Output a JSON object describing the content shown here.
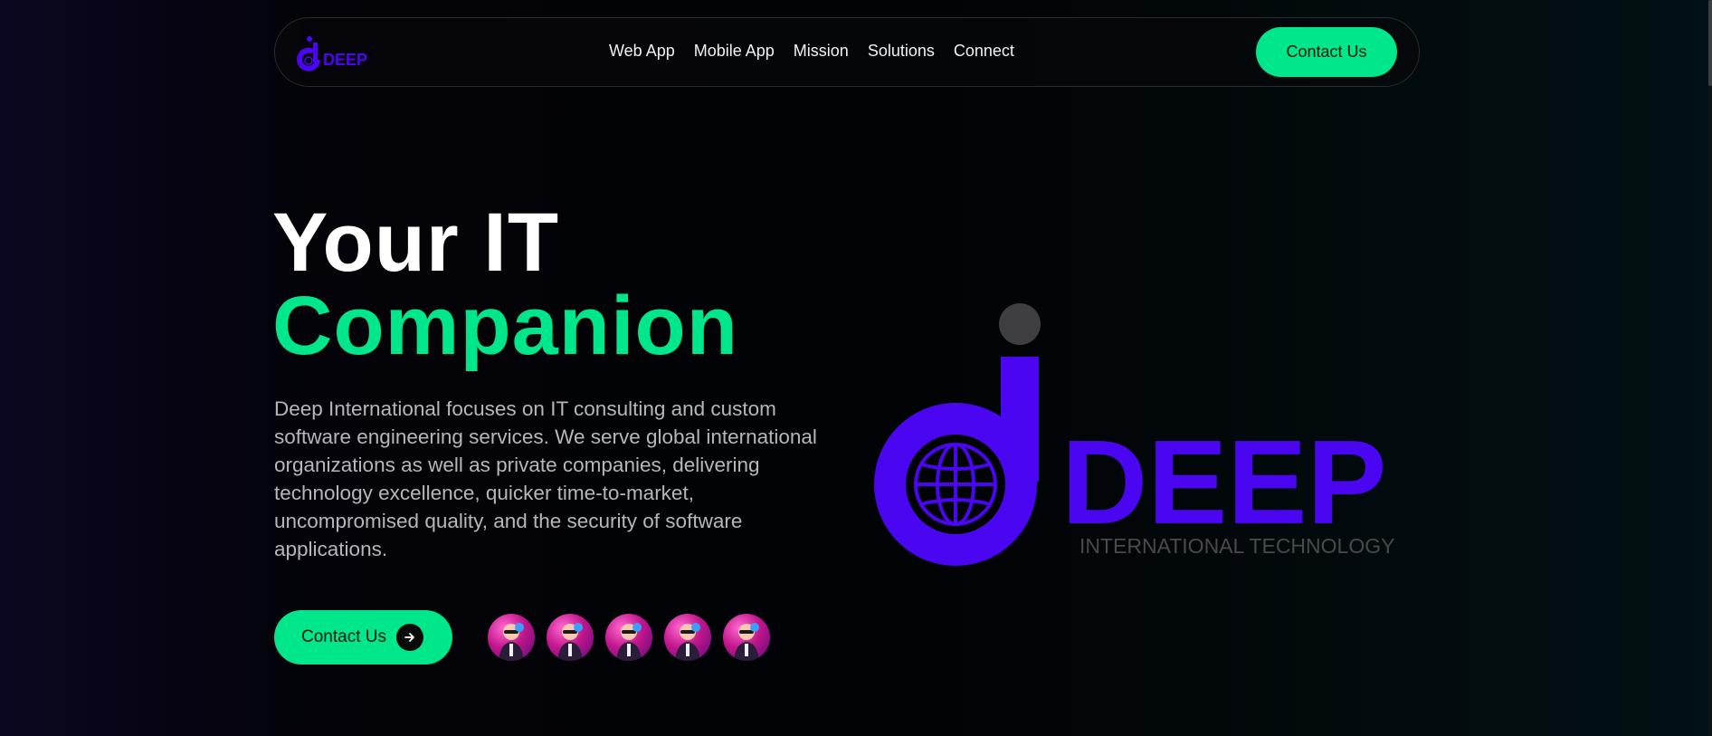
{
  "nav": {
    "logo_text": "DEEP",
    "links": [
      "Web App",
      "Mobile App",
      "Mission",
      "Solutions",
      "Connect"
    ],
    "cta_label": "Contact Us"
  },
  "hero": {
    "title_line1": "Your IT",
    "title_line2": "Companion",
    "description": "Deep International focuses on IT consulting and custom software engineering services. We serve global international organizations as well as private companies, delivering technology excellence, quicker time-to-market, uncompromised quality, and the security of software applications.",
    "cta_label": "Contact Us",
    "avatar_count": 5
  },
  "brand": {
    "name": "DEEP",
    "tagline": "INTERNATIONAL TECHNOLOGY"
  },
  "colors": {
    "accent_green": "#00e68a",
    "brand_purple": "#4a06f0",
    "tagline_gray": "#4a4a4e",
    "dot_gray": "#3f3f42"
  },
  "icons": {
    "hero_cta": "arrow-right-icon",
    "brand_globe": "globe-icon"
  }
}
